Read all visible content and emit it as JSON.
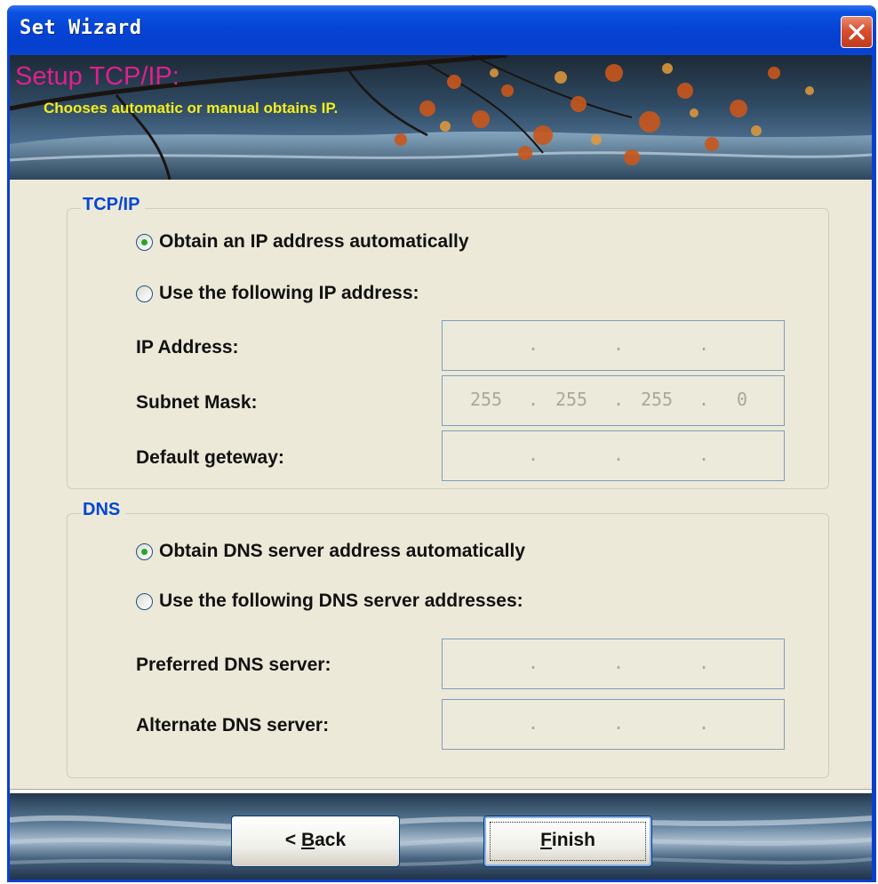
{
  "window": {
    "title": "Set Wizard",
    "close_icon": "close-icon"
  },
  "header": {
    "title": "Setup TCP/IP:",
    "subtitle": "Chooses automatic or manual obtains IP.",
    "colors": {
      "title": "#e0208d",
      "subtitle": "#f3ee1c"
    }
  },
  "tcpip": {
    "legend": "TCP/IP",
    "option_auto": "Obtain an IP address automatically",
    "option_manual": "Use the following IP address:",
    "selected": "auto",
    "fields": {
      "ip_address": {
        "label": "IP Address:",
        "octets": [
          "",
          "",
          "",
          ""
        ]
      },
      "subnet_mask": {
        "label": "Subnet Mask:",
        "octets": [
          "255",
          "255",
          "255",
          "0"
        ]
      },
      "default_gateway": {
        "label": "Default geteway:",
        "octets": [
          "",
          "",
          "",
          ""
        ]
      }
    }
  },
  "dns": {
    "legend": "DNS",
    "option_auto": "Obtain DNS server address automatically",
    "option_manual": "Use the following DNS server addresses:",
    "selected": "auto",
    "fields": {
      "preferred": {
        "label": "Preferred DNS server:",
        "octets": [
          "",
          "",
          "",
          ""
        ]
      },
      "alternate": {
        "label": "Alternate DNS server:",
        "octets": [
          "",
          "",
          "",
          ""
        ]
      }
    }
  },
  "buttons": {
    "back": {
      "prefix": "< ",
      "mnemonic": "B",
      "rest": "ack"
    },
    "finish": {
      "mnemonic": "F",
      "rest": "inish"
    }
  },
  "colors": {
    "group_title": "#0046d5",
    "radio_selected": "#2aa52a",
    "titlebar": "#0645d6"
  }
}
